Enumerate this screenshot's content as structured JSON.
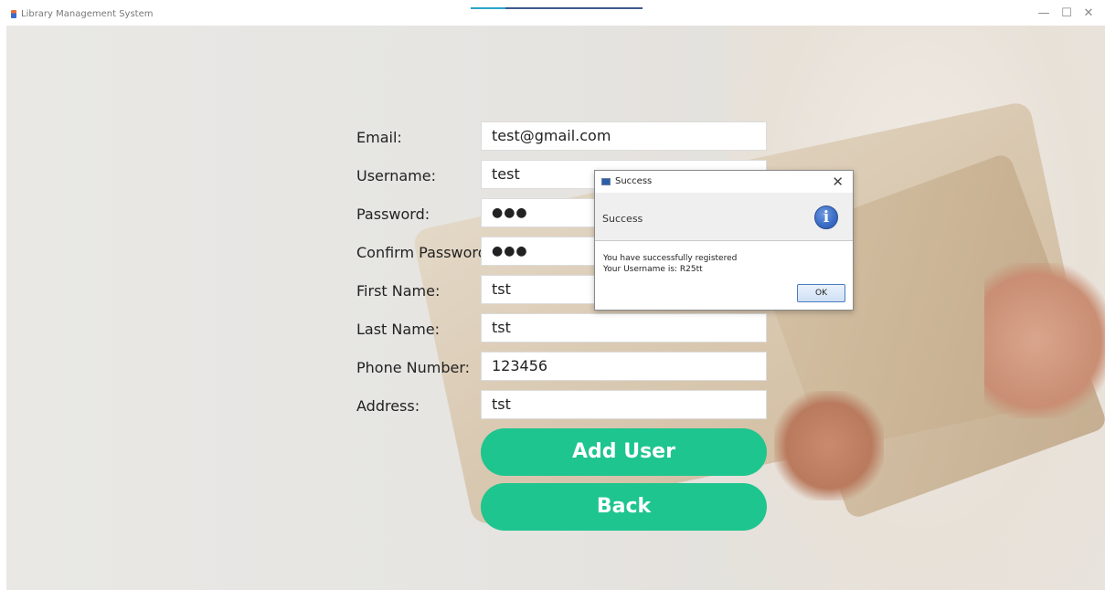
{
  "window": {
    "title": "Library Management System",
    "minimize_glyph": "—",
    "maximize_glyph": "☐",
    "close_glyph": "✕"
  },
  "form": {
    "fields": [
      {
        "label": "Email:",
        "value": "test@gmail.com"
      },
      {
        "label": "Username:",
        "value": "test"
      },
      {
        "label": "Password:",
        "value": "●●●"
      },
      {
        "label": "Confirm Password:",
        "value": "●●●"
      },
      {
        "label": "First Name:",
        "value": "tst"
      },
      {
        "label": "Last Name:",
        "value": "tst"
      },
      {
        "label": "Phone Number:",
        "value": "123456"
      },
      {
        "label": "Address:",
        "value": "tst"
      }
    ],
    "add_user_label": "Add User",
    "back_label": "Back"
  },
  "dialog": {
    "title": "Success",
    "header": "Success",
    "message_line1": "You have successfully registered",
    "message_line2": "Your Username is: R25tt",
    "ok_label": "OK",
    "close_glyph": "✕",
    "info_glyph": "i"
  },
  "colors": {
    "button_green": "#1ec58e",
    "info_blue": "#3b6fc8"
  }
}
